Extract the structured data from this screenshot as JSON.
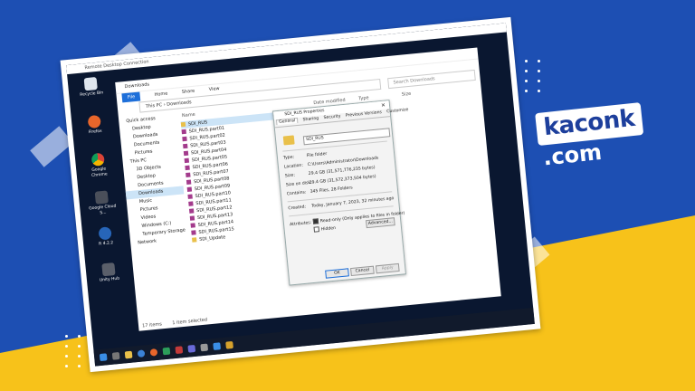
{
  "brand": {
    "logo_main": "kaconk",
    "logo_domain": ".com"
  },
  "remote": {
    "title": "Remote Desktop Connection"
  },
  "desktop_icons": [
    {
      "label": "Recycle Bin",
      "color": "#dfe6ee"
    },
    {
      "label": "Firefox",
      "color": "#e8662b"
    },
    {
      "label": "Google Chrome",
      "color": "#3b82d6"
    },
    {
      "label": "Google Cloud S...",
      "color": "#4a4f5a"
    },
    {
      "label": "R 4.2.2",
      "color": "#2765b8"
    },
    {
      "label": "Unity Hub",
      "color": "#5a5f6a"
    }
  ],
  "explorer": {
    "title": "Downloads",
    "ribbon": [
      "File",
      "Home",
      "Share",
      "View"
    ],
    "address": "This PC  ›  Downloads",
    "search_placeholder": "Search Downloads",
    "nav": [
      {
        "label": "Quick access",
        "indent": false
      },
      {
        "label": "Desktop",
        "indent": true
      },
      {
        "label": "Downloads",
        "indent": true
      },
      {
        "label": "Documents",
        "indent": true
      },
      {
        "label": "Pictures",
        "indent": true
      },
      {
        "label": "This PC",
        "indent": false
      },
      {
        "label": "3D Objects",
        "indent": true
      },
      {
        "label": "Desktop",
        "indent": true
      },
      {
        "label": "Documents",
        "indent": true
      },
      {
        "label": "Downloads",
        "indent": true,
        "selected": true
      },
      {
        "label": "Music",
        "indent": true
      },
      {
        "label": "Pictures",
        "indent": true
      },
      {
        "label": "Videos",
        "indent": true
      },
      {
        "label": "Windows (C:)",
        "indent": true
      },
      {
        "label": "Temporary Storage",
        "indent": true
      },
      {
        "label": "Network",
        "indent": false
      }
    ],
    "columns": {
      "name": "Name",
      "date": "Date modified",
      "type": "Type",
      "size": "Size"
    },
    "files": [
      "SDI_RUS",
      "SDI_RUS.part01",
      "SDI_RUS.part02",
      "SDI_RUS.part03",
      "SDI_RUS.part04",
      "SDI_RUS.part05",
      "SDI_RUS.part06",
      "SDI_RUS.part07",
      "SDI_RUS.part08",
      "SDI_RUS.part09",
      "SDI_RUS.part10",
      "SDI_RUS.part11",
      "SDI_RUS.part12",
      "SDI_RUS.part13",
      "SDI_RUS.part14",
      "SDI_RUS.part15",
      "SDI_Update"
    ],
    "status_items": "17 items",
    "status_selected": "1 item selected"
  },
  "properties": {
    "title": "SDI_RUS Properties",
    "tabs": [
      "General",
      "Sharing",
      "Security",
      "Previous Versions",
      "Customize"
    ],
    "name_value": "SDI_RUS",
    "type_label": "Type:",
    "type_value": "File folder",
    "location_label": "Location:",
    "location_value": "C:\\Users\\Administrator\\Downloads",
    "size_label": "Size:",
    "size_value": "29.4 GB (31,571,776,235 bytes)",
    "sizeondisk_label": "Size on disk:",
    "sizeondisk_value": "29.4 GB (31,572,373,504 bytes)",
    "contains_label": "Contains:",
    "contains_value": "345 Files, 28 Folders",
    "created_label": "Created:",
    "created_value": "Today, January 7, 2023, 32 minutes ago",
    "attributes_label": "Attributes:",
    "readonly_label": "Read-only (Only applies to files in folder)",
    "hidden_label": "Hidden",
    "advanced_label": "Advanced...",
    "ok_label": "OK",
    "cancel_label": "Cancel",
    "apply_label": "Apply"
  }
}
